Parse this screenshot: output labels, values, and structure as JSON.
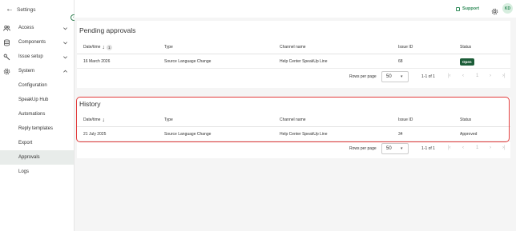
{
  "sidebar": {
    "title": "Settings",
    "items": [
      {
        "label": "Access",
        "icon": "users-icon",
        "expandable": true,
        "expanded": false
      },
      {
        "label": "Components",
        "icon": "database-icon",
        "expandable": true,
        "expanded": false
      },
      {
        "label": "Issue setup",
        "icon": "wrench-icon",
        "expandable": true,
        "expanded": false
      },
      {
        "label": "System",
        "icon": "gear-icon",
        "expandable": true,
        "expanded": true
      }
    ],
    "subitems": [
      {
        "label": "Configuration"
      },
      {
        "label": "SpeakUp Hub"
      },
      {
        "label": "Automations"
      },
      {
        "label": "Reply templates"
      },
      {
        "label": "Export"
      },
      {
        "label": "Approvals",
        "active": true
      },
      {
        "label": "Logs"
      }
    ]
  },
  "topbar": {
    "support_label": "Support",
    "avatar_initials": "KD"
  },
  "columns": {
    "datetime": "Date/time",
    "type": "Type",
    "channel": "Channel name",
    "issue_id": "Issue ID",
    "status": "Status"
  },
  "pending": {
    "title": "Pending approvals",
    "filter_count": "1",
    "rows": [
      {
        "datetime": "16 March 2026",
        "type": "Source Language Change",
        "channel": "Help Center SpeakUp Line",
        "issue_id": "68",
        "status": "Open"
      }
    ],
    "pager": {
      "rows_per_page_label": "Rows per page",
      "rows_per_page": "50",
      "range": "1-1 of 1",
      "page": "1"
    }
  },
  "history": {
    "title": "History",
    "rows": [
      {
        "datetime": "21 July 2025",
        "type": "Source Language Change",
        "channel": "Help Center SpeakUp Line",
        "issue_id": "34",
        "status": "Approved"
      }
    ],
    "pager": {
      "rows_per_page_label": "Rows per page",
      "rows_per_page": "50",
      "range": "1-1 of 1",
      "page": "1"
    }
  },
  "colors": {
    "accent": "#2f8a58",
    "badge_open": "#1c5d38",
    "highlight": "#e23b3b",
    "active_bg": "#e8ecea"
  }
}
